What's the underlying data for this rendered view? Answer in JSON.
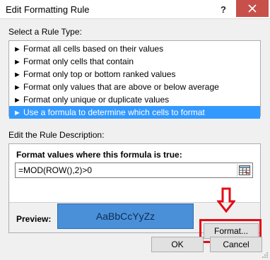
{
  "window": {
    "title": "Edit Formatting Rule",
    "help_label": "?",
    "close_icon": "close-icon"
  },
  "rule_type": {
    "label": "Select a Rule Type:",
    "items": [
      {
        "label": "Format all cells based on their values",
        "selected": false
      },
      {
        "label": "Format only cells that contain",
        "selected": false
      },
      {
        "label": "Format only top or bottom ranked values",
        "selected": false
      },
      {
        "label": "Format only values that are above or below average",
        "selected": false
      },
      {
        "label": "Format only unique or duplicate values",
        "selected": false
      },
      {
        "label": "Use a formula to determine which cells to format",
        "selected": true
      }
    ]
  },
  "description": {
    "label": "Edit the Rule Description:",
    "formula_label": "Format values where this formula is true:",
    "formula_value": "=MOD(ROW(),2)>0",
    "preview_label": "Preview:",
    "preview_text": "AaBbCcYyZz",
    "preview_color": "#4a90d9",
    "format_button": "Format..."
  },
  "buttons": {
    "ok": "OK",
    "cancel": "Cancel"
  },
  "annotation": {
    "color": "#e10d16"
  }
}
